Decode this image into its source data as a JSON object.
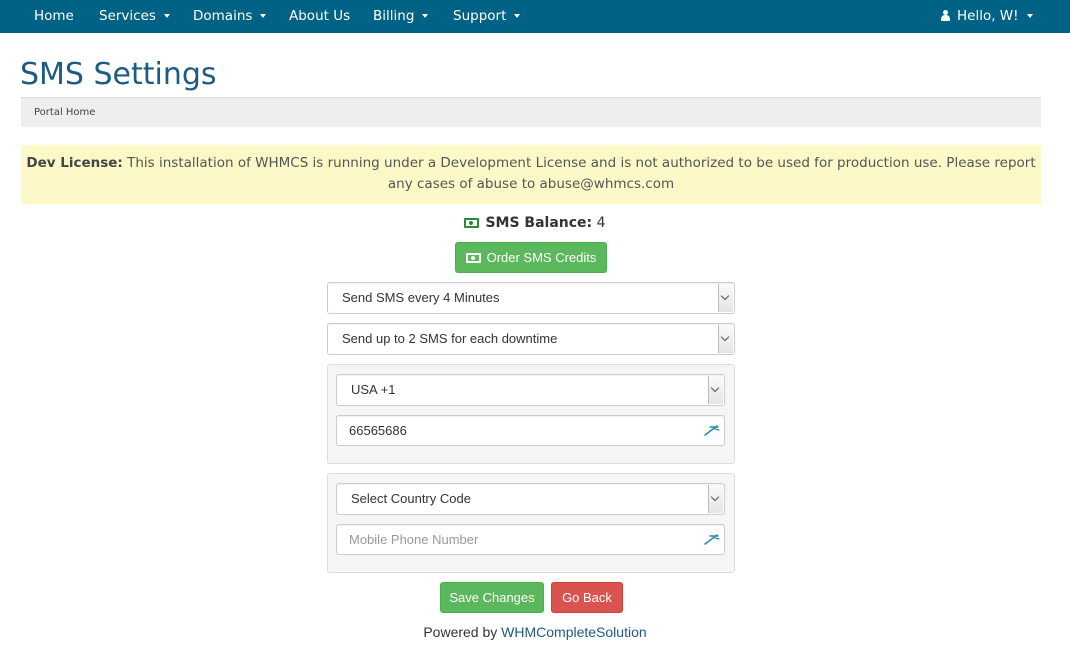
{
  "navbar": {
    "items": [
      {
        "label": "Home"
      },
      {
        "label": "Services"
      },
      {
        "label": "Domains"
      },
      {
        "label": "About Us"
      },
      {
        "label": "Billing"
      },
      {
        "label": "Support"
      }
    ],
    "user_label": "Hello, W!"
  },
  "header": {
    "title": "SMS Settings",
    "breadcrumb": "Portal Home"
  },
  "alert": {
    "strong": "Dev License:",
    "text": " This installation of WHMCS is running under a Development License and is not authorized to be used for production use. Please report any cases of abuse to abuse@whmcs.com"
  },
  "balance": {
    "label": "SMS Balance:",
    "value": "4"
  },
  "order_button": "Order SMS Credits",
  "form": {
    "frequency_select": "Send SMS every 4 Minutes",
    "limit_select": "Send up to 2 SMS for each downtime",
    "phone1": {
      "country": "USA +1",
      "number": "66565686"
    },
    "phone2": {
      "country": "Select Country Code",
      "number_placeholder": "Mobile Phone Number"
    }
  },
  "actions": {
    "save": "Save Changes",
    "back": "Go Back"
  },
  "footer": {
    "prefix": "Powered by ",
    "link": "WHMCompleteSolution"
  },
  "colors": {
    "navbar": "#006284",
    "title": "#1c5b82",
    "success": "#5cb85c",
    "danger": "#d9534f",
    "alert_bg": "#fcf8c7"
  }
}
